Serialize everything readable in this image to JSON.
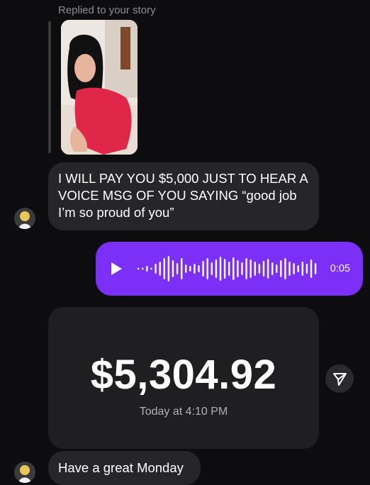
{
  "story_reply": {
    "label": "Replied to your story"
  },
  "messages": [
    {
      "text": "I WILL PAY YOU $5,000 JUST TO HEAR A VOICE MSG OF YOU SAYING “good job I’m so proud of you”"
    },
    {
      "text": "Have a great Monday"
    }
  ],
  "voice_message": {
    "duration": "0:05",
    "color": "#7b2ff7"
  },
  "payment_card": {
    "amount": "$5,304.92",
    "timestamp": "Today at 4:10 PM"
  },
  "icons": {
    "play": "play-icon",
    "share": "paper-plane-icon"
  }
}
